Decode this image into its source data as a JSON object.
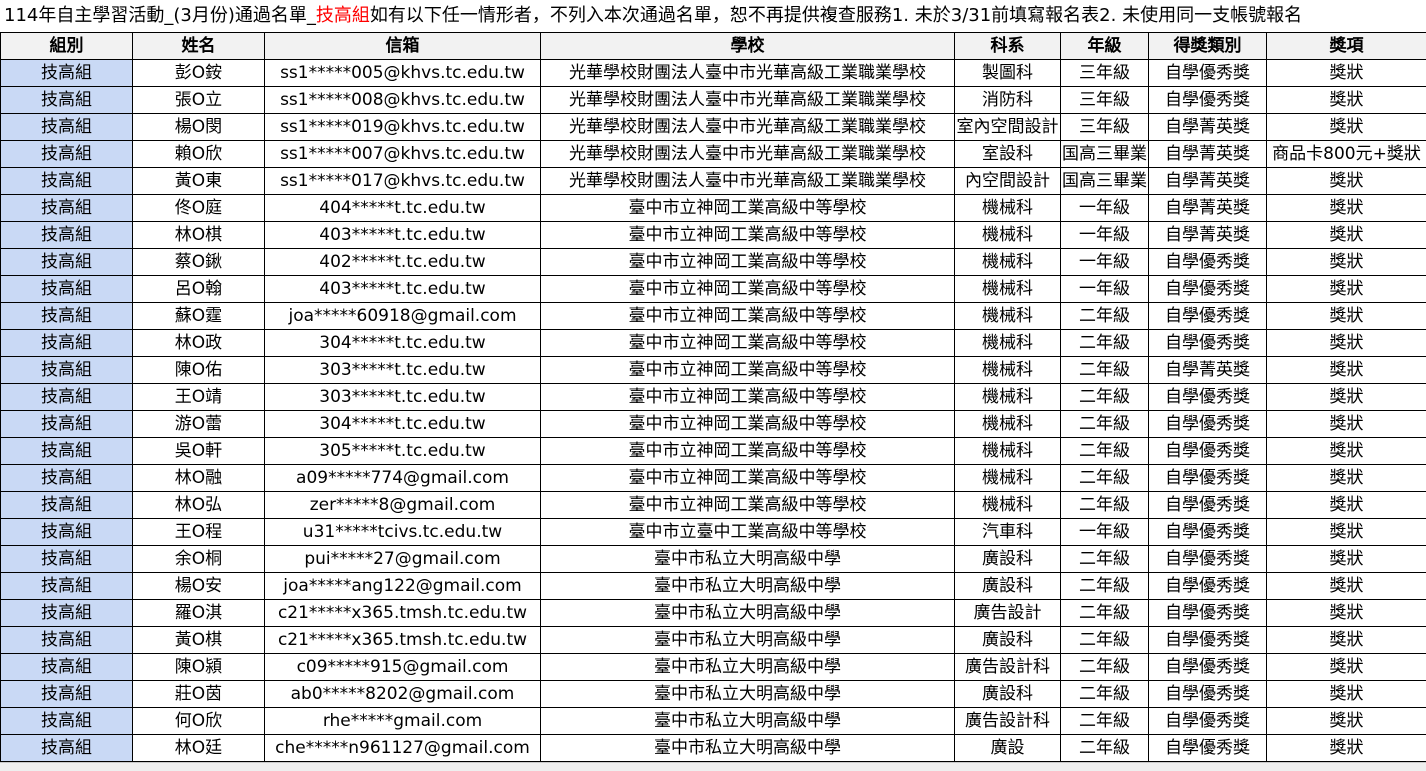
{
  "sheet": {
    "title_prefix": "114年自主學習活動_(3月份)通過名單_",
    "title_highlight": "技高組",
    "title_suffix": "如有以下任一情形者，不列入本次通過名單，恕不再提供複查服務1. 未於3/31前填寫報名表2. 未使用同一支帳號報名",
    "highlight_color": "#ff0000",
    "group_cell_color": "#c9d9f5"
  },
  "table": {
    "headers": [
      "組別",
      "姓名",
      "信箱",
      "學校",
      "科系",
      "年級",
      "得獎類別",
      "獎項"
    ],
    "rows": [
      [
        "技高組",
        "彭O銨",
        "ss1*****005@khvs.tc.edu.tw",
        "光華學校財團法人臺中市光華高級工業職業學校",
        "製圖科",
        "三年級",
        "自學優秀獎",
        "獎狀"
      ],
      [
        "技高組",
        "張O立",
        "ss1*****008@khvs.tc.edu.tw",
        "光華學校財團法人臺中市光華高級工業職業學校",
        "消防科",
        "三年級",
        "自學優秀獎",
        "獎狀"
      ],
      [
        "技高組",
        "楊O閔",
        "ss1*****019@khvs.tc.edu.tw",
        "光華學校財團法人臺中市光華高級工業職業學校",
        "室內空間設計",
        "三年級",
        "自學菁英獎",
        "獎狀"
      ],
      [
        "技高組",
        "賴O欣",
        "ss1*****007@khvs.tc.edu.tw",
        "光華學校財團法人臺中市光華高級工業職業學校",
        "室設科",
        "国高三畢業",
        "自學菁英獎",
        "商品卡800元+獎狀"
      ],
      [
        "技高組",
        "黃O東",
        "ss1*****017@khvs.tc.edu.tw",
        "光華學校財團法人臺中市光華高級工業職業學校",
        "內空間設計",
        "国高三畢業",
        "自學菁英獎",
        "獎狀"
      ],
      [
        "技高組",
        "佟O庭",
        "404*****t.tc.edu.tw",
        "臺中市立神岡工業高級中等學校",
        "機械科",
        "一年級",
        "自學菁英獎",
        "獎狀"
      ],
      [
        "技高組",
        "林O棋",
        "403*****t.tc.edu.tw",
        "臺中市立神岡工業高級中等學校",
        "機械科",
        "一年級",
        "自學菁英獎",
        "獎狀"
      ],
      [
        "技高組",
        "蔡O鍬",
        "402*****t.tc.edu.tw",
        "臺中市立神岡工業高級中等學校",
        "機械科",
        "一年級",
        "自學優秀獎",
        "獎狀"
      ],
      [
        "技高組",
        "呂O翰",
        "403*****t.tc.edu.tw",
        "臺中市立神岡工業高級中等學校",
        "機械科",
        "一年級",
        "自學優秀獎",
        "獎狀"
      ],
      [
        "技高組",
        "蘇O霆",
        "joa*****60918@gmail.com",
        "臺中市立神岡工業高級中等學校",
        "機械科",
        "二年級",
        "自學優秀獎",
        "獎狀"
      ],
      [
        "技高組",
        "林O政",
        "304*****t.tc.edu.tw",
        "臺中市立神岡工業高級中等學校",
        "機械科",
        "二年級",
        "自學優秀獎",
        "獎狀"
      ],
      [
        "技高組",
        "陳O佑",
        "303*****t.tc.edu.tw",
        "臺中市立神岡工業高級中等學校",
        "機械科",
        "二年級",
        "自學菁英獎",
        "獎狀"
      ],
      [
        "技高組",
        "王O靖",
        "303*****t.tc.edu.tw",
        "臺中市立神岡工業高級中等學校",
        "機械科",
        "二年級",
        "自學優秀獎",
        "獎狀"
      ],
      [
        "技高組",
        "游O蕾",
        "304*****t.tc.edu.tw",
        "臺中市立神岡工業高級中等學校",
        "機械科",
        "二年級",
        "自學優秀獎",
        "獎狀"
      ],
      [
        "技高組",
        "吳O軒",
        "305*****t.tc.edu.tw",
        "臺中市立神岡工業高級中等學校",
        "機械科",
        "二年級",
        "自學優秀獎",
        "獎狀"
      ],
      [
        "技高組",
        "林O融",
        "a09*****774@gmail.com",
        "臺中市立神岡工業高級中等學校",
        "機械科",
        "二年級",
        "自學優秀獎",
        "獎狀"
      ],
      [
        "技高組",
        "林O弘",
        "zer*****8@gmail.com",
        "臺中市立神岡工業高級中等學校",
        "機械科",
        "二年級",
        "自學優秀獎",
        "獎狀"
      ],
      [
        "技高組",
        "王O程",
        "u31*****tcivs.tc.edu.tw",
        "臺中市立臺中工業高級中等學校",
        "汽車科",
        "一年級",
        "自學優秀獎",
        "獎狀"
      ],
      [
        "技高組",
        "余O桐",
        "pui*****27@gmail.com",
        "臺中市私立大明高級中學",
        "廣設科",
        "二年級",
        "自學優秀獎",
        "獎狀"
      ],
      [
        "技高組",
        "楊O安",
        "joa*****ang122@gmail.com",
        "臺中市私立大明高級中學",
        "廣設科",
        "二年級",
        "自學優秀獎",
        "獎狀"
      ],
      [
        "技高組",
        "羅O淇",
        "c21*****x365.tmsh.tc.edu.tw",
        "臺中市私立大明高級中學",
        "廣告設計",
        "二年級",
        "自學優秀獎",
        "獎狀"
      ],
      [
        "技高組",
        "黃O棋",
        "c21*****x365.tmsh.tc.edu.tw",
        "臺中市私立大明高級中學",
        "廣設科",
        "二年級",
        "自學優秀獎",
        "獎狀"
      ],
      [
        "技高組",
        "陳O潁",
        "c09*****915@gmail.com",
        "臺中市私立大明高級中學",
        "廣告設計科",
        "二年級",
        "自學優秀獎",
        "獎狀"
      ],
      [
        "技高組",
        "莊O茵",
        "ab0*****8202@gmail.com",
        "臺中市私立大明高級中學",
        "廣設科",
        "二年級",
        "自學優秀獎",
        "獎狀"
      ],
      [
        "技高組",
        "何O欣",
        "rhe*****gmail.com",
        "臺中市私立大明高級中學",
        "廣告設計科",
        "二年級",
        "自學優秀獎",
        "獎狀"
      ],
      [
        "技高組",
        "林O廷",
        "che*****n961127@gmail.com",
        "臺中市私立大明高級中學",
        "廣設",
        "二年級",
        "自學優秀獎",
        "獎狀"
      ]
    ]
  }
}
